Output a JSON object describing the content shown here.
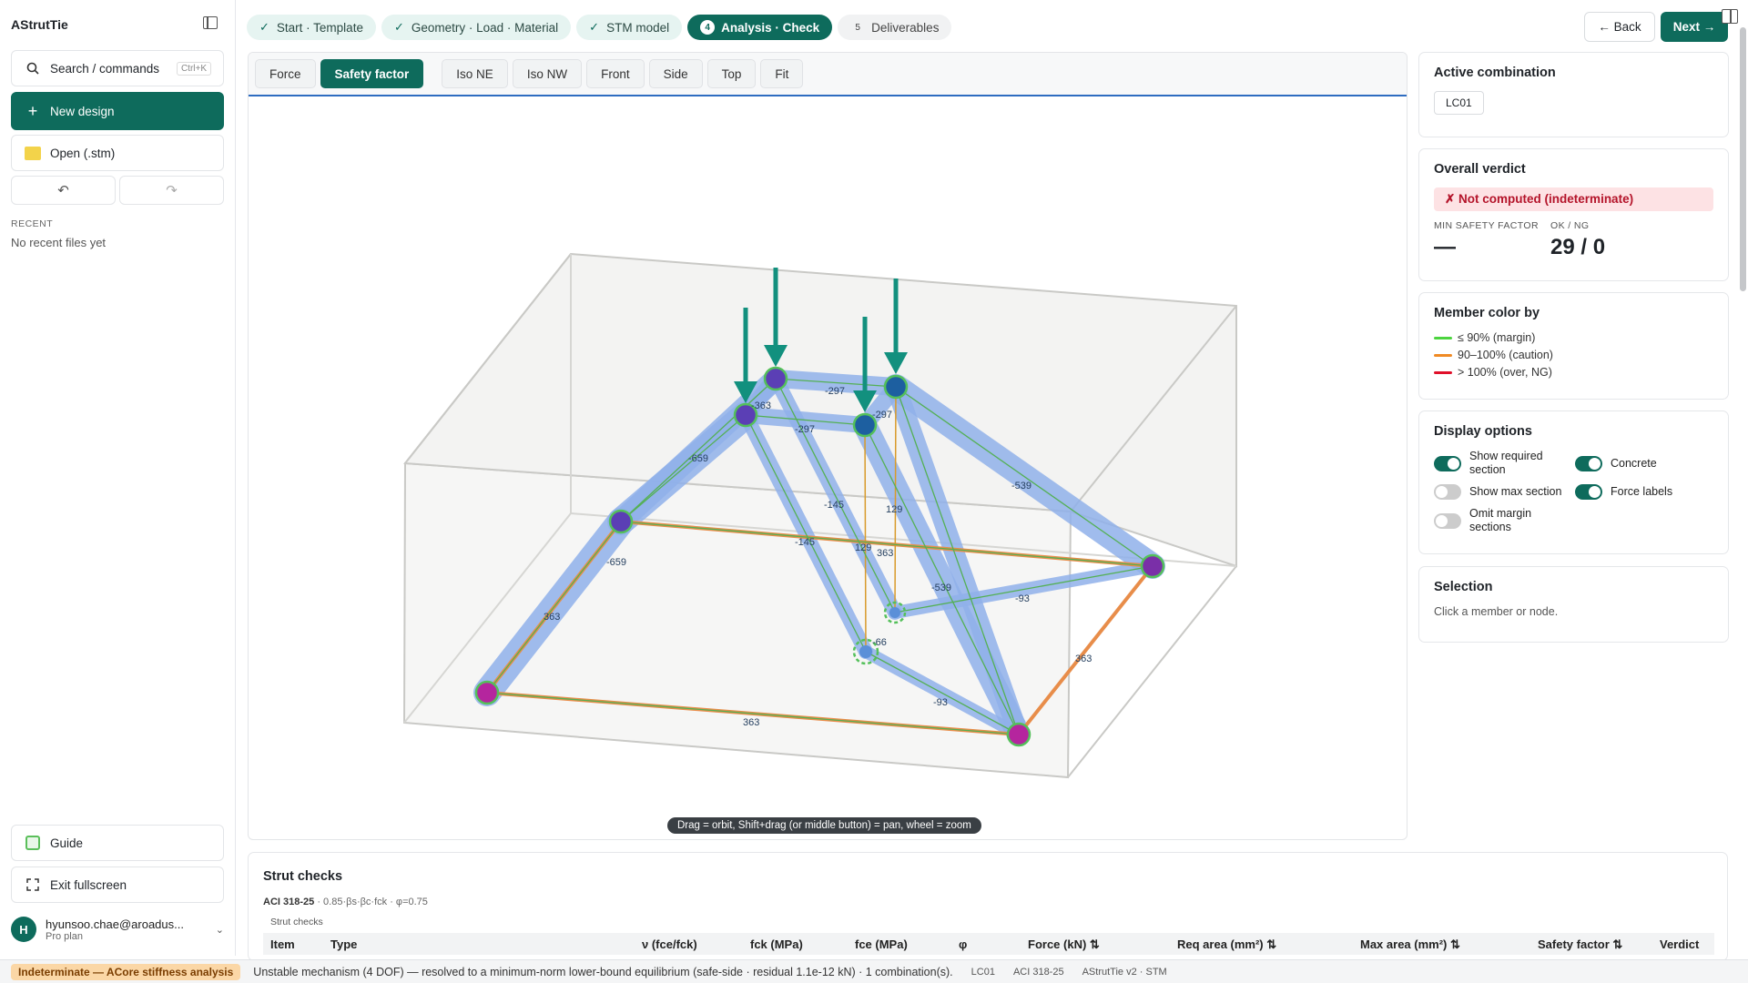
{
  "app": {
    "name": "AStrutTie"
  },
  "sidebar": {
    "search_label": "Search / commands",
    "search_shortcut": "Ctrl+K",
    "new_design": "New design",
    "open": "Open (.stm)",
    "recent_heading": "RECENT",
    "recent_empty": "No recent files yet",
    "guide": "Guide",
    "exit_fullscreen": "Exit fullscreen",
    "user": {
      "initial": "H",
      "name": "hyunsoo.chae@aroadus...",
      "plan": "Pro plan"
    }
  },
  "steps": [
    {
      "label": "Start · Template",
      "state": "done"
    },
    {
      "label": "Geometry · Load · Material",
      "state": "done"
    },
    {
      "label": "STM model",
      "state": "done"
    },
    {
      "number": "4",
      "label": "Analysis · Check",
      "state": "active"
    },
    {
      "number": "5",
      "label": "Deliverables",
      "state": "todo"
    }
  ],
  "nav": {
    "back": "← Back",
    "next": "Next →"
  },
  "viewport": {
    "modes": [
      "Force",
      "Safety factor"
    ],
    "active_mode": "Safety factor",
    "views": [
      "Iso NE",
      "Iso NW",
      "Front",
      "Side",
      "Top",
      "Fit"
    ],
    "hint": "Drag = orbit, Shift+drag (or middle button) = pan, wheel = zoom",
    "force_labels": [
      "-297",
      "-363",
      "-297",
      "-297",
      "-659",
      "-659",
      "-145",
      "-145",
      "129",
      "129",
      "363",
      "-539",
      "-539",
      "-93",
      "-93",
      "-66",
      "363",
      "363",
      "363"
    ]
  },
  "panel": {
    "active_combination": {
      "title": "Active combination",
      "value": "LC01"
    },
    "verdict": {
      "title": "Overall verdict",
      "status": "✗ Not computed (indeterminate)",
      "min_sf_label": "MIN SAFETY FACTOR",
      "min_sf_value": "—",
      "okng_label": "OK / NG",
      "okng_value": "29 / 0"
    },
    "member_color": {
      "title": "Member color by",
      "legend": [
        {
          "label": "≤ 90% (margin)",
          "color": "#4cd43f"
        },
        {
          "label": "90–100% (caution)",
          "color": "#f08a24"
        },
        {
          "label": "> 100% (over, NG)",
          "color": "#e0102a"
        }
      ]
    },
    "display_options": {
      "title": "Display options",
      "show_required_section": {
        "label": "Show required section",
        "on": true
      },
      "concrete": {
        "label": "Concrete",
        "on": true
      },
      "show_max_section": {
        "label": "Show max section",
        "on": false
      },
      "force_labels": {
        "label": "Force labels",
        "on": true
      },
      "omit_margin_sections": {
        "label": "Omit margin sections",
        "on": false
      }
    },
    "selection": {
      "title": "Selection",
      "hint": "Click a member or node."
    }
  },
  "strut_checks": {
    "title": "Strut checks",
    "code": "ACI 318-25",
    "formula": "· 0.85·βs·βc·fck · φ=0.75",
    "subheading": "Strut checks",
    "columns": [
      "Item",
      "Type",
      "ν (fce/fck)",
      "fck (MPa)",
      "fce (MPa)",
      "φ",
      "Force (kN) ⇅",
      "Req area (mm²) ⇅",
      "Max area (mm²) ⇅",
      "Safety factor ⇅",
      "Verdict"
    ]
  },
  "status": {
    "badge": "Indeterminate — ACore stiffness analysis",
    "message": "Unstable mechanism (4 DOF) — resolved to a minimum-norm lower-bound equilibrium (safe-side · residual 1.1e-12 kN) · 1 combination(s).",
    "combo": "LC01",
    "code": "ACI 318-25",
    "version": "AStrutTie v2 · STM"
  }
}
